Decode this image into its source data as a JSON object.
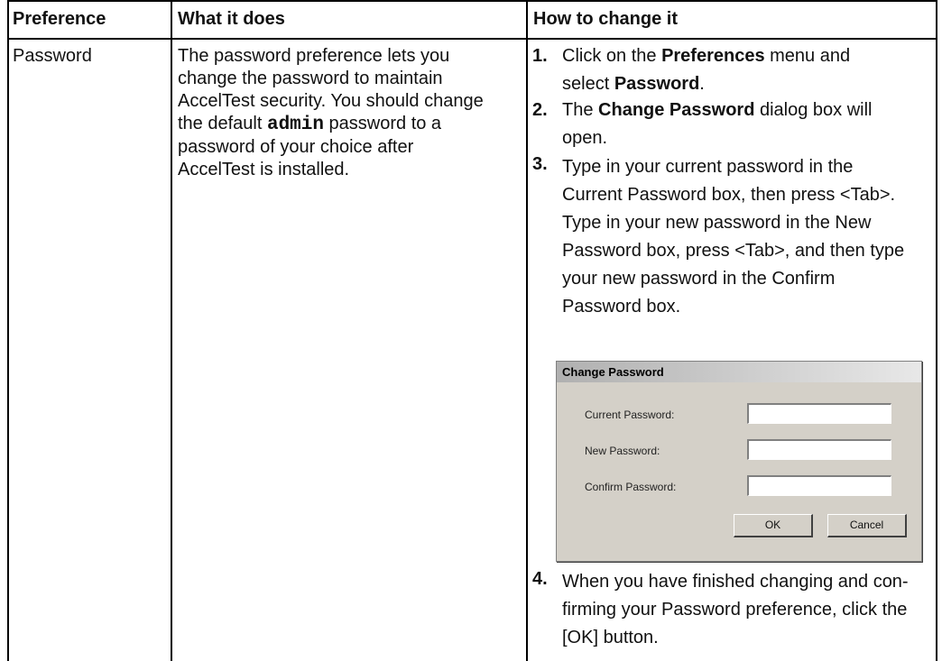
{
  "headers": {
    "preference": "Preference",
    "what": "What it does",
    "how": "How to change it"
  },
  "row": {
    "preference": "Password",
    "what_lines": [
      "The password preference lets you",
      "change the password to maintain",
      "AccelTest security. You should change"
    ],
    "what_line4_pre": "the default ",
    "what_line4_code": "admin",
    "what_line4_post": " password to a",
    "what_lines_tail": [
      "password of your choice after",
      "AccelTest is installed."
    ]
  },
  "steps": {
    "s1": {
      "num": "1.",
      "t1": "Click on the ",
      "b1": "Preferences",
      "t2": " menu and",
      "t3": "select ",
      "b2": "Password",
      "t4": "."
    },
    "s2": {
      "num": "2.",
      "t1": "The ",
      "b1": "Change Password",
      "t2": " dialog box will",
      "t3": "open."
    },
    "s3": {
      "num": "3.",
      "lines": [
        "Type in your current password in the",
        "Current Password box, then press <Tab>.",
        "Type in your new password in the New",
        "Password box, press <Tab>, and then type",
        "your new password in the Confirm",
        "Password box."
      ]
    },
    "s4": {
      "num": "4.",
      "lines": [
        "When you have finished changing and con-",
        "firming your Password preference, click the",
        "[OK] button."
      ]
    }
  },
  "dialog": {
    "title": "Change Password",
    "current_label": "Current Password:",
    "new_label": "New Password:",
    "confirm_label": "Confirm Password:",
    "current_value": "",
    "new_value": "",
    "confirm_value": "",
    "ok_label": "OK",
    "cancel_label": "Cancel"
  }
}
